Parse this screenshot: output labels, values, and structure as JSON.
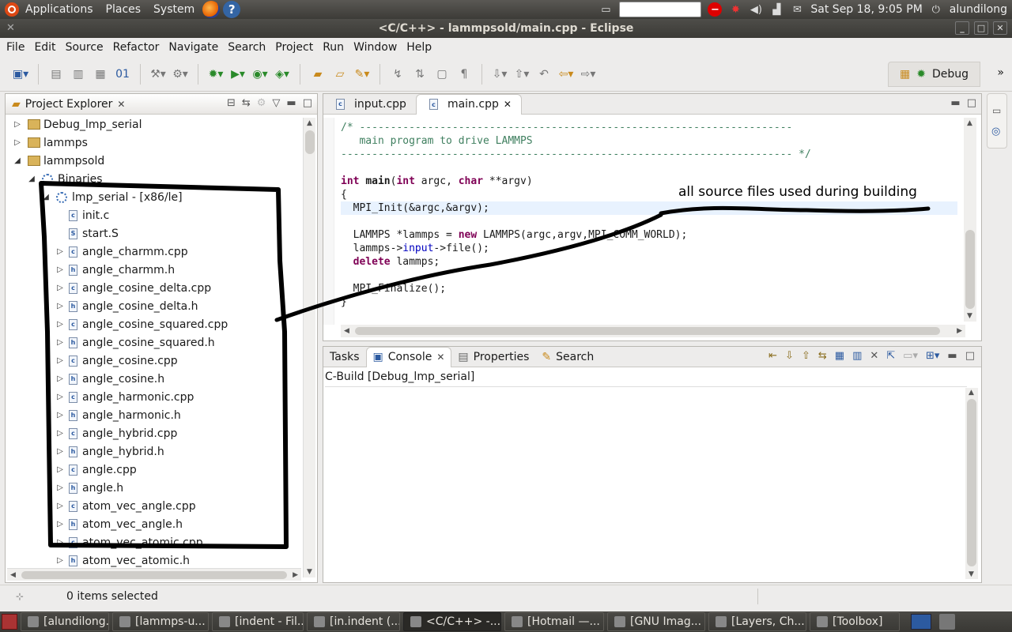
{
  "top_panel": {
    "menus": [
      "Applications",
      "Places",
      "System"
    ],
    "clock": "Sat Sep 18,  9:05 PM",
    "user": "alundilong"
  },
  "window": {
    "title": "<C/C++> - lammpsold/main.cpp - Eclipse"
  },
  "menubar": [
    "File",
    "Edit",
    "Source",
    "Refactor",
    "Navigate",
    "Search",
    "Project",
    "Run",
    "Window",
    "Help"
  ],
  "perspective": {
    "label": "Debug"
  },
  "project_explorer": {
    "title": "Project Explorer",
    "items": [
      {
        "label": "Debug_lmp_serial",
        "indent": 0,
        "twisty": "▷",
        "kind": "project"
      },
      {
        "label": "lammps",
        "indent": 0,
        "twisty": "▷",
        "kind": "project"
      },
      {
        "label": "lammpsold",
        "indent": 0,
        "twisty": "◢",
        "kind": "project"
      },
      {
        "label": "Binaries",
        "indent": 1,
        "twisty": "◢",
        "kind": "binaries"
      },
      {
        "label": "lmp_serial - [x86/le]",
        "indent": 2,
        "twisty": "◢",
        "kind": "binaries"
      },
      {
        "label": "init.c",
        "indent": 3,
        "twisty": "",
        "kind": "c"
      },
      {
        "label": "start.S",
        "indent": 3,
        "twisty": "",
        "kind": "s"
      },
      {
        "label": "angle_charmm.cpp",
        "indent": 3,
        "twisty": "▷",
        "kind": "c"
      },
      {
        "label": "angle_charmm.h",
        "indent": 3,
        "twisty": "▷",
        "kind": "h"
      },
      {
        "label": "angle_cosine_delta.cpp",
        "indent": 3,
        "twisty": "▷",
        "kind": "c"
      },
      {
        "label": "angle_cosine_delta.h",
        "indent": 3,
        "twisty": "▷",
        "kind": "h"
      },
      {
        "label": "angle_cosine_squared.cpp",
        "indent": 3,
        "twisty": "▷",
        "kind": "c"
      },
      {
        "label": "angle_cosine_squared.h",
        "indent": 3,
        "twisty": "▷",
        "kind": "h"
      },
      {
        "label": "angle_cosine.cpp",
        "indent": 3,
        "twisty": "▷",
        "kind": "c"
      },
      {
        "label": "angle_cosine.h",
        "indent": 3,
        "twisty": "▷",
        "kind": "h"
      },
      {
        "label": "angle_harmonic.cpp",
        "indent": 3,
        "twisty": "▷",
        "kind": "c"
      },
      {
        "label": "angle_harmonic.h",
        "indent": 3,
        "twisty": "▷",
        "kind": "h"
      },
      {
        "label": "angle_hybrid.cpp",
        "indent": 3,
        "twisty": "▷",
        "kind": "c"
      },
      {
        "label": "angle_hybrid.h",
        "indent": 3,
        "twisty": "▷",
        "kind": "h"
      },
      {
        "label": "angle.cpp",
        "indent": 3,
        "twisty": "▷",
        "kind": "c"
      },
      {
        "label": "angle.h",
        "indent": 3,
        "twisty": "▷",
        "kind": "h"
      },
      {
        "label": "atom_vec_angle.cpp",
        "indent": 3,
        "twisty": "▷",
        "kind": "c"
      },
      {
        "label": "atom_vec_angle.h",
        "indent": 3,
        "twisty": "▷",
        "kind": "h"
      },
      {
        "label": "atom_vec_atomic.cpp",
        "indent": 3,
        "twisty": "▷",
        "kind": "c"
      },
      {
        "label": "atom_vec_atomic.h",
        "indent": 3,
        "twisty": "▷",
        "kind": "h"
      }
    ]
  },
  "editor": {
    "tabs": [
      {
        "label": "input.cpp",
        "active": false
      },
      {
        "label": "main.cpp",
        "active": true
      }
    ],
    "code": {
      "l1_comment": "/* ----------------------------------------------------------------------",
      "l2_comment": "   main program to drive LAMMPS",
      "l3_comment": "------------------------------------------------------------------------- */",
      "l4_kw1": "int",
      "l4_fn": "main",
      "l4_a": "(",
      "l4_kw2": "int",
      "l4_b": " argc, ",
      "l4_kw3": "char",
      "l4_c": " **argv)",
      "l5": "{",
      "l6": "  MPI_Init(&argc,&argv);",
      "l7_a": "  LAMMPS *lammps = ",
      "l7_kw": "new",
      "l7_b": " LAMMPS(argc,argv,MPI_COMM_WORLD);",
      "l8_a": "  lammps->",
      "l8_member": "input",
      "l8_b": "->file();",
      "l9_kw": "delete",
      "l9_b": " lammps;",
      "l10": "  MPI_Finalize();",
      "l11": "}"
    }
  },
  "console": {
    "tabs": [
      "Tasks",
      "Console",
      "Properties",
      "Search"
    ],
    "header": "C-Build [Debug_lmp_serial]"
  },
  "status_bar": {
    "text": "0 items selected"
  },
  "taskbar": [
    {
      "label": "[alundilong...",
      "active": false
    },
    {
      "label": "[lammps-u...",
      "active": false
    },
    {
      "label": "[indent - Fil...",
      "active": false
    },
    {
      "label": "[in.indent (...",
      "active": false
    },
    {
      "label": "<C/C++> -...",
      "active": true
    },
    {
      "label": "[Hotmail —...",
      "active": false
    },
    {
      "label": "[GNU Imag...",
      "active": false
    },
    {
      "label": "[Layers, Ch...",
      "active": false
    },
    {
      "label": "[Toolbox]",
      "active": false
    }
  ],
  "annotation": {
    "text": "all source files used during building"
  },
  "colors": {
    "keyword": "#7f0055",
    "comment": "#3f7f5f",
    "member": "#0000c0",
    "panel": "#3c3b37"
  }
}
